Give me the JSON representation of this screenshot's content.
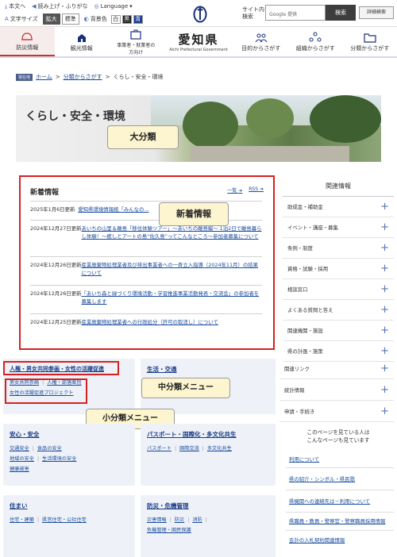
{
  "header": {
    "util": {
      "read_aloud": "本文へ",
      "ruby": "読み上げ・ふりがな",
      "language": "Language",
      "text_size_label": "文字サイズ",
      "text_size_large": "拡大",
      "text_size_std": "標準",
      "bg_label": "背景色",
      "bg_white": "白",
      "bg_black": "黒",
      "bg_blue": "青"
    },
    "logo_title": "愛知県",
    "logo_sub": "Aichi Prefectural Government",
    "search_label_1": "サイト内",
    "search_label_2": "検索",
    "search_placeholder": "Google 提供",
    "search_button": "検索",
    "advanced_search": "詳細検索"
  },
  "nav": {
    "items": [
      {
        "label": "防災情報"
      },
      {
        "label": "観光情報"
      },
      {
        "label": "事業者・就業者の方向け"
      },
      {
        "label": "目的からさがす"
      },
      {
        "label": "組織からさがす"
      },
      {
        "label": "分類からさがす"
      }
    ]
  },
  "breadcrumb": {
    "current_badge": "現在地",
    "home": "ホーム",
    "sep": ">",
    "level1": "分類からさがす",
    "level2": "くらし・安全・環境"
  },
  "hero": {
    "title": "くらし・安全・環境",
    "callout": "大分類"
  },
  "news": {
    "title": "新着情報",
    "list_link": "一覧",
    "rss_link": "RSS",
    "callout": "新着情報",
    "items": [
      {
        "date": "2025年1月6日更新",
        "text": "愛知県環境情報紙「みんなの..."
      },
      {
        "date": "2024年12月27日更新",
        "text": "あいちの山里＆離島「移住体験ツアー」～あいちの離島編～ 1泊2日で離島暮らし体験！～癒しとアートの島“佐久島”ってこんなところ～参加者募集について"
      },
      {
        "date": "2024年12月26日更新",
        "text": "産業廃棄物処理業者及び排出事業者への一斉立入指導（2024年11月）の結果について"
      },
      {
        "date": "2024年12月26日更新",
        "text": "「あいち森と緑づくり環境活動・学習推進事業活動発表・交流会」の参加者を募集します"
      },
      {
        "date": "2024年12月25日更新",
        "text": "産業廃棄物処理業者への行政処分（許可の取消し）について"
      }
    ]
  },
  "sidebar": {
    "title": "関連情報",
    "items": [
      {
        "label": "助成金・補助金"
      },
      {
        "label": "イベント・講座・募集"
      },
      {
        "label": "条例・制度"
      },
      {
        "label": "資格・試験・採用"
      },
      {
        "label": "相談窓口"
      },
      {
        "label": "よくある質問と答え"
      },
      {
        "label": "関連機関・施設"
      },
      {
        "label": "県の計画・施策"
      }
    ],
    "sections": [
      {
        "label": "関連リンク"
      },
      {
        "label": "統計情報"
      },
      {
        "label": "申請・手続き"
      }
    ],
    "survey_text_1": "このページを見ている人は",
    "survey_text_2": "こんなページも見ています",
    "survey_links": [
      {
        "label": "利用について"
      },
      {
        "label": "県の紹介・シンボル・県民歌"
      },
      {
        "label": "県機関への連絡先は－利用について"
      },
      {
        "label": "県職員・教員・警察官・警察職員採用情報"
      },
      {
        "label": "会計の入札契約関連情報"
      }
    ]
  },
  "categories": {
    "mid_callout": "中分類メニュー",
    "sub_callout": "小分類メニュー",
    "blocks": [
      {
        "title": "人権・男女共同参画・女性の活躍促進",
        "links": [
          "男女共同参画",
          "人権・部落差別",
          "女性の活躍促進プロジェクト"
        ]
      },
      {
        "title": "生活・交通",
        "links": []
      },
      {
        "title": "安心・安全",
        "links": [
          "交通安全",
          "食品の安全",
          "地域の安全",
          "生活環境の安全",
          "健康被害"
        ]
      },
      {
        "title": "パスポート・国際化・多文化共生",
        "links": [
          "パスポート",
          "国際交流",
          "多文化共生"
        ]
      },
      {
        "title": "住まい",
        "links": [
          "住宅・建築",
          "県営住宅・公社住宅"
        ]
      },
      {
        "title": "防災・危機管理",
        "links": [
          "災害情報",
          "防災",
          "消防",
          "危機管理・国民保護"
        ]
      }
    ]
  },
  "colors": {
    "accent_red": "#d82020",
    "link_blue": "#1a4c9c",
    "callout_bg": "#fdf5cf",
    "category_bg": "#eef2f8"
  }
}
